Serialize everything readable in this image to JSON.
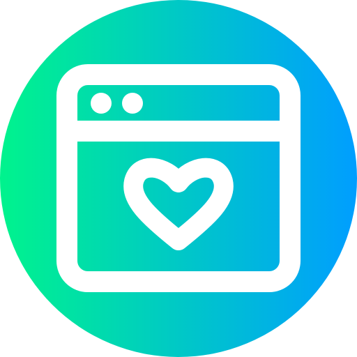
{
  "icon": {
    "name": "browser-window-heart-icon",
    "background": {
      "shape": "circle",
      "gradient_start": "#00F38D",
      "gradient_end": "#009EFF"
    },
    "foreground_color": "#FFFFFF",
    "elements": {
      "window": "browser-window-icon",
      "title_dots": [
        "window-dot-icon",
        "window-dot-icon"
      ],
      "heart": "heart-icon"
    }
  }
}
